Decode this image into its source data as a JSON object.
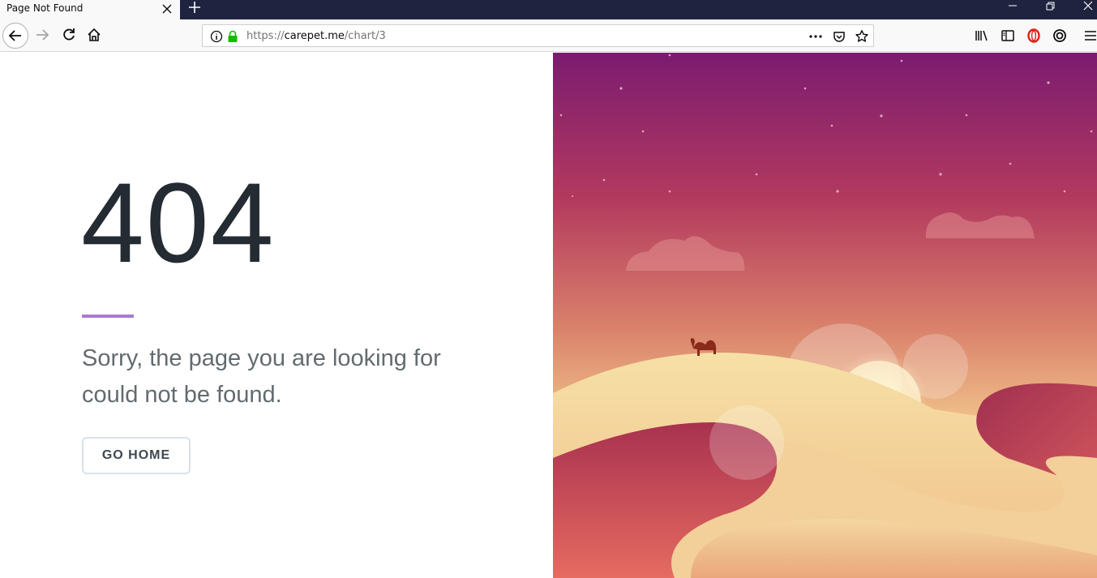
{
  "browser": {
    "tab_title": "Page Not Found",
    "url_scheme": "https://",
    "url_host": "carepet.me",
    "url_path": "/chart/3",
    "icons": [
      "close-icon",
      "plus-icon",
      "minimize-icon",
      "restore-icon",
      "window-close-icon",
      "back-icon",
      "forward-icon",
      "reload-icon",
      "home-icon",
      "info-icon",
      "lock-icon",
      "more-icon",
      "pocket-icon",
      "star-icon",
      "library-icon",
      "sidebar-icon",
      "opera-icon",
      "sync-icon",
      "menu-icon"
    ]
  },
  "page": {
    "code": "404",
    "message": "Sorry, the page you are looking for could not be found.",
    "button_label": "GO HOME",
    "accent_color": "#a97bd1",
    "illustration": "desert-camel-illustration"
  }
}
